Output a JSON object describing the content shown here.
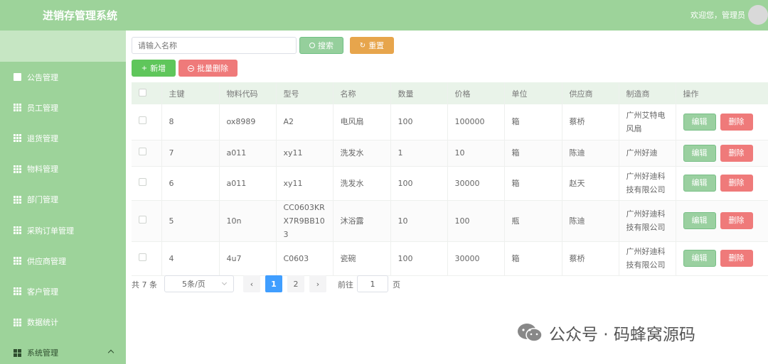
{
  "header": {
    "title": "进销存管理系统",
    "welcome": "欢迎您，管理员"
  },
  "sidebar": {
    "items": [
      {
        "label": "公告管理",
        "icon": "comment-icon"
      },
      {
        "label": "员工管理",
        "icon": "grid-icon"
      },
      {
        "label": "退货管理",
        "icon": "grid-icon"
      },
      {
        "label": "物料管理",
        "icon": "grid-icon"
      },
      {
        "label": "部门管理",
        "icon": "grid-icon"
      },
      {
        "label": "采购订单管理",
        "icon": "grid-icon"
      },
      {
        "label": "供应商管理",
        "icon": "grid-icon"
      },
      {
        "label": "客户管理",
        "icon": "grid-icon"
      },
      {
        "label": "数据统计",
        "icon": "grid-icon"
      },
      {
        "label": "系统管理",
        "icon": "apps-icon"
      }
    ]
  },
  "toolbar": {
    "search_placeholder": "请输入名称",
    "search_label": "搜索",
    "reset_label": "重置",
    "add_label": "新增",
    "batch_delete_label": "批量删除"
  },
  "table": {
    "columns": [
      "主键",
      "物料代码",
      "型号",
      "名称",
      "数量",
      "价格",
      "单位",
      "供应商",
      "制造商",
      "操作"
    ],
    "edit_label": "编辑",
    "delete_label": "删除",
    "rows": [
      {
        "id": "8",
        "code": "ox8989",
        "model": "A2",
        "name": "电风扇",
        "qty": "100",
        "price": "100000",
        "unit": "箱",
        "supplier": "蔡桥",
        "maker": "广州艾特电风扇"
      },
      {
        "id": "7",
        "code": "a011",
        "model": "xy11",
        "name": "洗发水",
        "qty": "1",
        "price": "10",
        "unit": "箱",
        "supplier": "陈迪",
        "maker": "广州好迪"
      },
      {
        "id": "6",
        "code": "a011",
        "model": "xy11",
        "name": "洗发水",
        "qty": "100",
        "price": "30000",
        "unit": "箱",
        "supplier": "赵天",
        "maker": "广州好迪科技有限公司"
      },
      {
        "id": "5",
        "code": "10n",
        "model": "CC0603KRX7R9BB103",
        "name": "沐浴露",
        "qty": "10",
        "price": "100",
        "unit": "瓶",
        "supplier": "陈迪",
        "maker": "广州好迪科技有限公司"
      },
      {
        "id": "4",
        "code": "4u7",
        "model": "C0603",
        "name": "瓷碗",
        "qty": "100",
        "price": "30000",
        "unit": "箱",
        "supplier": "蔡桥",
        "maker": "广州好迪科技有限公司"
      }
    ]
  },
  "pagination": {
    "total_text": "共 7 条",
    "page_size": "5条/页",
    "pages": [
      "1",
      "2"
    ],
    "current_page": "1",
    "goto_label": "前往",
    "goto_value": "1",
    "page_unit": "页",
    "prev_icon": "chevron-left-icon",
    "next_icon": "chevron-right-icon"
  },
  "watermark": {
    "text": "公众号 · 码蜂窝源码"
  },
  "colors": {
    "header_bg": "#9dd39a",
    "sidebar_bg": "#9dd39a",
    "primary_green": "#5fc65b",
    "danger": "#ef7a7a",
    "warning": "#e7a54c",
    "pager_active": "#409eff"
  }
}
